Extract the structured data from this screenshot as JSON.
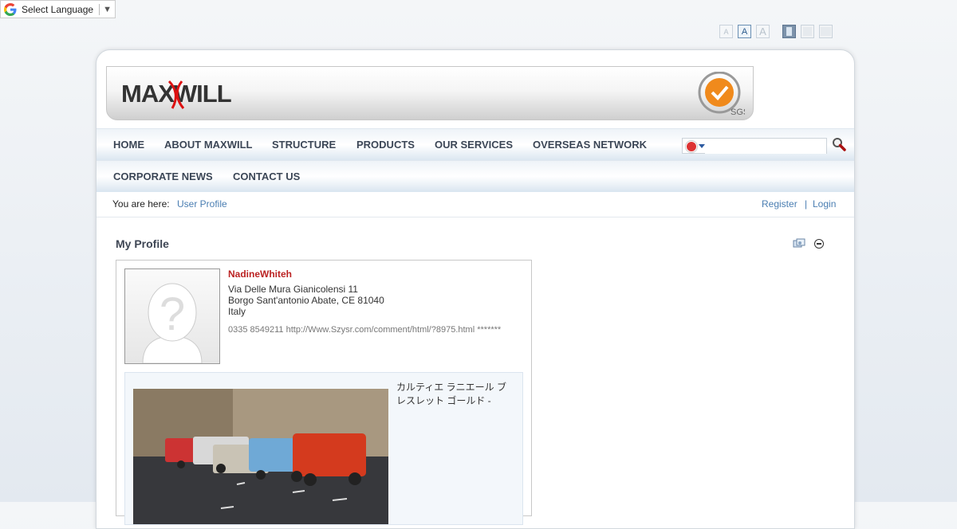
{
  "translate": {
    "label": "Select Language",
    "arrow": "▼"
  },
  "font_controls": [
    "A",
    "A",
    "A"
  ],
  "logo": {
    "text": "MAXWILL"
  },
  "cert": {
    "text": "SGS"
  },
  "nav": {
    "row1": [
      "HOME",
      "ABOUT MAXWILL",
      "STRUCTURE",
      "PRODUCTS",
      "OUR SERVICES",
      "OVERSEAS NETWORK"
    ],
    "row2": [
      "CORPORATE NEWS",
      "CONTACT US"
    ]
  },
  "search": {
    "value": "",
    "placeholder": ""
  },
  "breadcrumb": {
    "label": "You are here:",
    "path": "User Profile"
  },
  "auth": {
    "register": "Register",
    "separator": "|",
    "login": "Login"
  },
  "profile": {
    "title": "My Profile",
    "username": "NadineWhiteh",
    "address": [
      "Via Delle Mura Gianicolensi 11",
      "Borgo Sant'antonio Abate, CE 81040",
      "Italy"
    ],
    "contact": "0335 8549211 http://Www.Szysr.com/comment/html/?8975.html *******",
    "post_caption": "カルティエ ラニエール ブレスレット ゴールド -"
  }
}
